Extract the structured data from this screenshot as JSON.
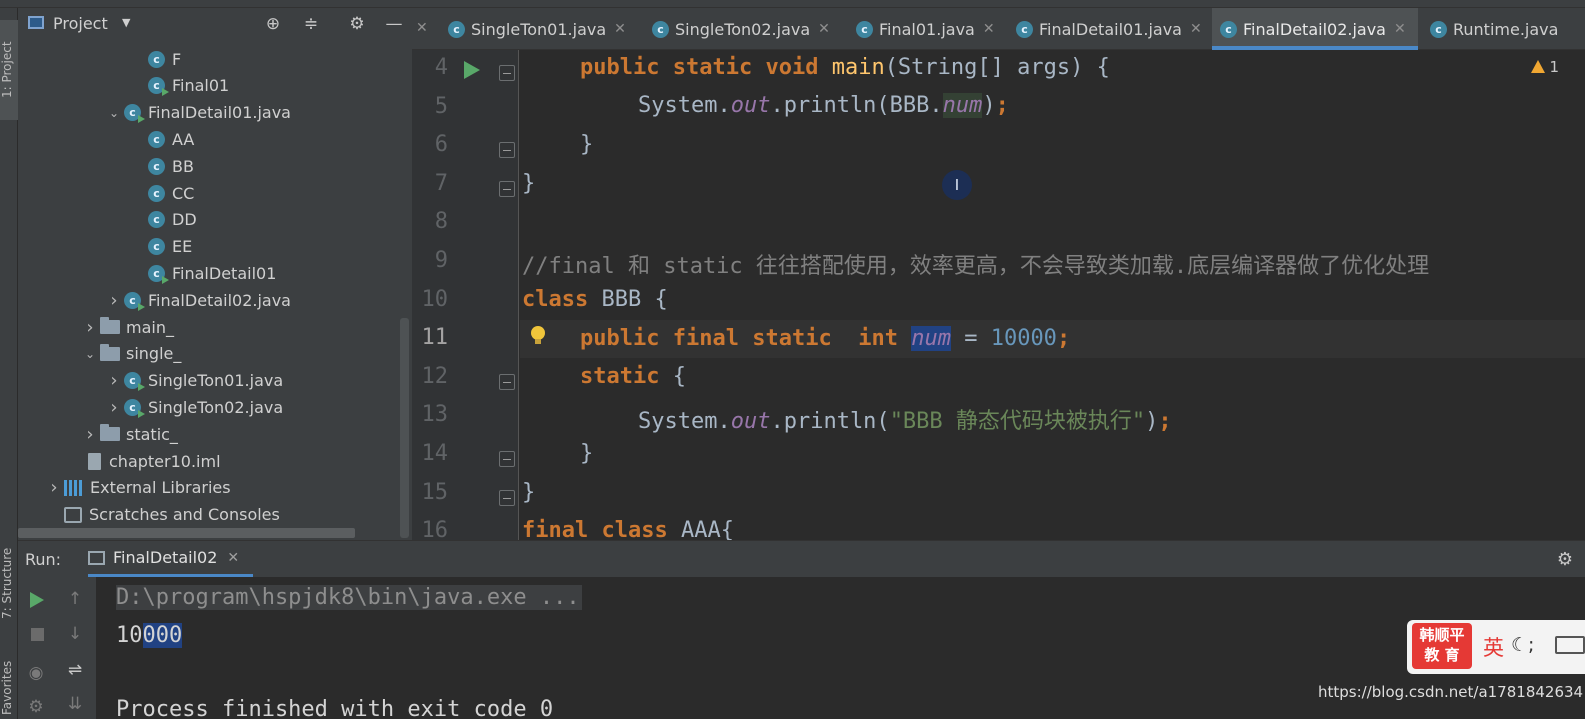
{
  "left_stripe": {
    "project_tab": "1: Project",
    "structure_tab": "7: Structure",
    "favorites_tab": "Favorites"
  },
  "project": {
    "title": "Project",
    "tree": [
      {
        "label": "F",
        "icon": "class-icon",
        "indent": 3,
        "arrow": ""
      },
      {
        "label": "Final01",
        "icon": "runnable-class-icon",
        "indent": 3,
        "arrow": ""
      },
      {
        "label": "FinalDetail01.java",
        "icon": "runnable-class-icon",
        "indent": 2,
        "arrow": "expanded"
      },
      {
        "label": "AA",
        "icon": "class-icon",
        "indent": 3,
        "arrow": ""
      },
      {
        "label": "BB",
        "icon": "class-icon",
        "indent": 3,
        "arrow": ""
      },
      {
        "label": "CC",
        "icon": "class-icon",
        "indent": 3,
        "arrow": ""
      },
      {
        "label": "DD",
        "icon": "class-icon",
        "indent": 3,
        "arrow": ""
      },
      {
        "label": "EE",
        "icon": "class-icon",
        "indent": 3,
        "arrow": ""
      },
      {
        "label": "FinalDetail01",
        "icon": "runnable-class-icon",
        "indent": 3,
        "arrow": ""
      },
      {
        "label": "FinalDetail02.java",
        "icon": "runnable-class-icon",
        "indent": 2,
        "arrow": "collapsed"
      },
      {
        "label": "main_",
        "icon": "folder-icon",
        "indent": 1,
        "arrow": "collapsed"
      },
      {
        "label": "single_",
        "icon": "folder-icon",
        "indent": 1,
        "arrow": "expanded"
      },
      {
        "label": "SingleTon01.java",
        "icon": "runnable-class-icon",
        "indent": 2,
        "arrow": "collapsed"
      },
      {
        "label": "SingleTon02.java",
        "icon": "runnable-class-icon",
        "indent": 2,
        "arrow": "collapsed"
      },
      {
        "label": "static_",
        "icon": "folder-icon",
        "indent": 1,
        "arrow": "collapsed"
      },
      {
        "label": "chapter10.iml",
        "icon": "file-icon",
        "indent": 0.5,
        "arrow": ""
      },
      {
        "label": "External Libraries",
        "icon": "library-icon",
        "indent": -0.5,
        "arrow": "collapsed"
      },
      {
        "label": "Scratches and Consoles",
        "icon": "scratches-icon",
        "indent": -0.5,
        "arrow": ""
      }
    ]
  },
  "tabs": [
    {
      "label": "SingleTon01.java",
      "active": false
    },
    {
      "label": "SingleTon02.java",
      "active": false
    },
    {
      "label": "Final01.java",
      "active": false
    },
    {
      "label": "FinalDetail01.java",
      "active": false
    },
    {
      "label": "FinalDetail02.java",
      "active": true
    },
    {
      "label": "Runtime.java",
      "active": false
    }
  ],
  "editor": {
    "warning_count": "1",
    "line_numbers": [
      "4",
      "5",
      "6",
      "7",
      "8",
      "9",
      "10",
      "11",
      "12",
      "13",
      "14",
      "15",
      "16"
    ],
    "current_line": "11",
    "lines": {
      "l4_public": "public",
      "l4_static": "static",
      "l4_void": "void",
      "l4_main": "main",
      "l4_rest": "(String[] args) {",
      "l5_pre": "System.",
      "l5_out": "out",
      "l5_mid": ".println(BBB.",
      "l5_num": "num",
      "l5_close": ")",
      "l5_semi": ";",
      "l6": "}",
      "l7": "}",
      "l9": "//final 和 static 往往搭配使用，效率更高，不会导致类加载.底层编译器做了优化处理",
      "l10_class": "class",
      "l10_rest": " BBB {",
      "l11_public": "public",
      "l11_final": "final",
      "l11_static": "static",
      "l11_int": "int",
      "l11_num": "num",
      "l11_eq": " = ",
      "l11_val": "10000",
      "l11_semi": ";",
      "l12_static": "static",
      "l12_rest": " {",
      "l13_pre": "System.",
      "l13_out": "out",
      "l13_mid": ".println(",
      "l13_str": "\"BBB 静态代码块被执行\"",
      "l13_close": ")",
      "l13_semi": ";",
      "l14": "}",
      "l15": "}",
      "l16_final": "final",
      "l16_class": "class",
      "l16_rest": " AAA{"
    }
  },
  "run": {
    "label": "Run:",
    "tab": "FinalDetail02",
    "console": {
      "cmd": "D:\\program\\hspjdk8\\bin\\java.exe ...",
      "out_a": "10",
      "out_b": "000",
      "exit": "Process finished with exit code 0"
    }
  },
  "badge": {
    "logo_line1": "韩顺平",
    "logo_line2": "教 育",
    "lang": "英"
  },
  "watermark": "https://blog.csdn.net/a1781842634"
}
